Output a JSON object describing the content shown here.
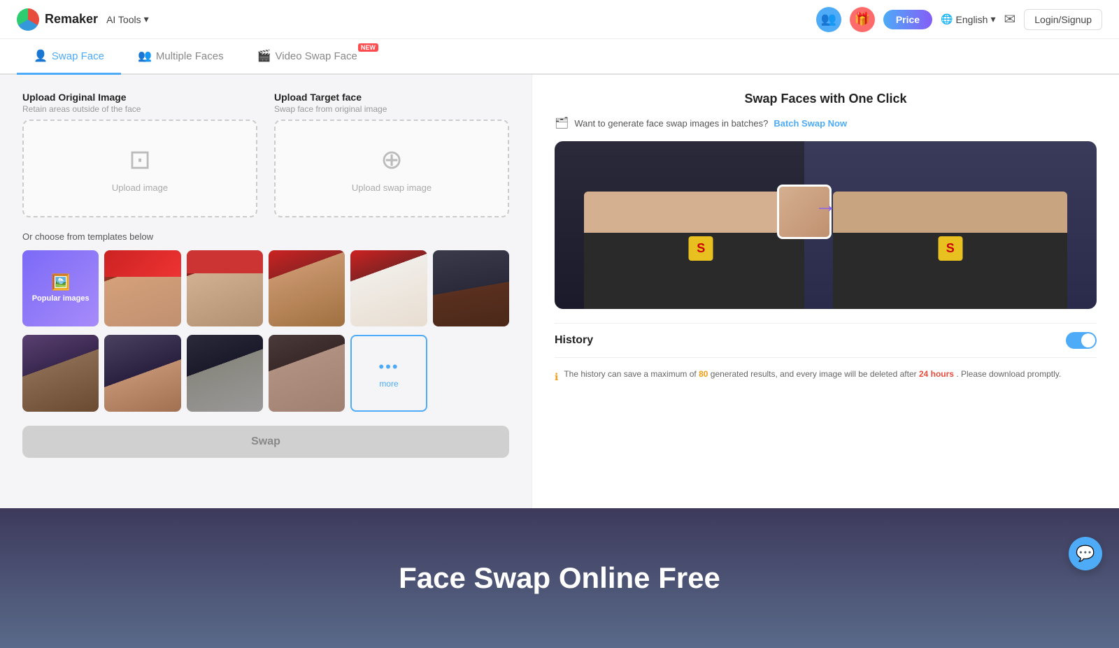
{
  "navbar": {
    "logo_text": "Remaker",
    "ai_tools_label": "AI Tools",
    "price_label": "Price",
    "lang_label": "English",
    "login_label": "Login/Signup"
  },
  "tabs": [
    {
      "id": "swap-face",
      "label": "Swap Face",
      "icon": "👤",
      "active": true,
      "new": false
    },
    {
      "id": "multiple-faces",
      "label": "Multiple Faces",
      "icon": "👥",
      "active": false,
      "new": false
    },
    {
      "id": "video-swap",
      "label": "Video Swap Face",
      "icon": "🎬",
      "active": false,
      "new": true
    }
  ],
  "upload": {
    "original_label": "Upload Original Image",
    "original_sub": "Retain areas outside of the face",
    "original_btn": "Upload image",
    "target_label": "Upload Target face",
    "target_sub": "Swap face from original image",
    "target_btn": "Upload swap image"
  },
  "templates": {
    "or_choose": "Or choose from templates below",
    "popular_label": "Popular images",
    "more_label": "more"
  },
  "swap_btn": "Swap",
  "right": {
    "title": "Swap Faces with One Click",
    "batch_text": "Want to generate face swap images in batches?",
    "batch_link": "Batch Swap Now",
    "history_label": "History",
    "history_info": "The history can save a maximum of",
    "history_max": "80",
    "history_info2": "generated results, and every image will be deleted after",
    "history_hours": "24 hours",
    "history_info3": ". Please download promptly."
  },
  "footer": {
    "title": "Face Swap Online Free"
  },
  "icons": {
    "chevron": "▾",
    "globe": "🌐",
    "mail": "✉",
    "stack": "🗂",
    "info": "ℹ",
    "chat": "💬",
    "upload": "⊡",
    "globe2": "⊕",
    "dots": "•••"
  }
}
